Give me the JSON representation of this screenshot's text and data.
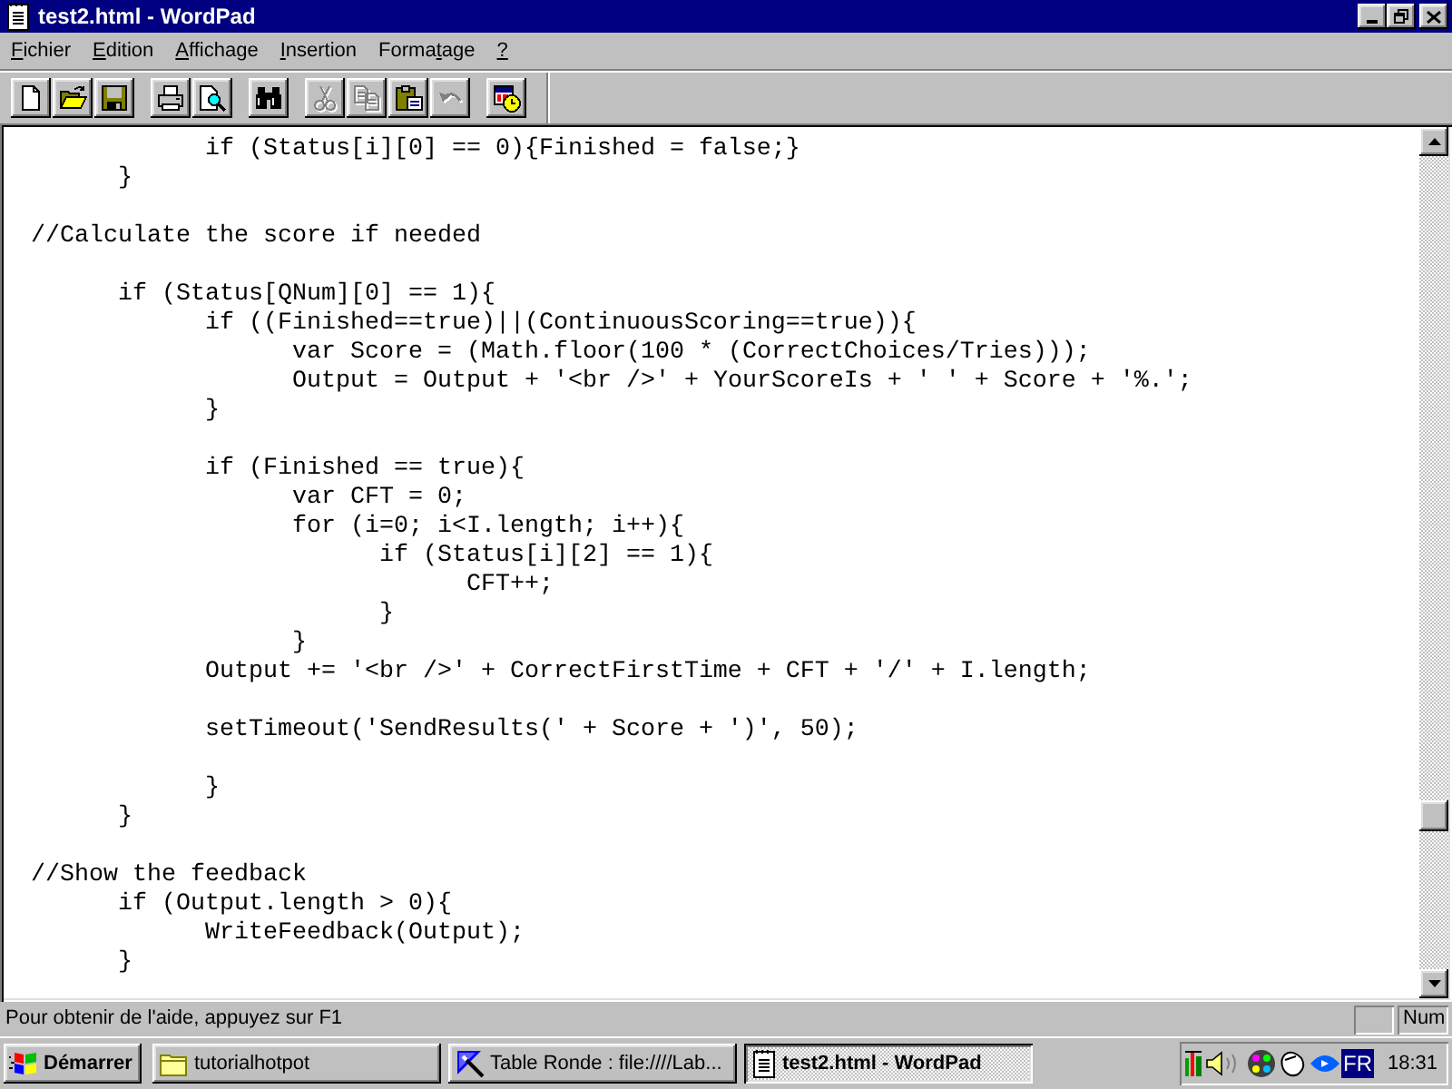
{
  "window": {
    "title": "test2.html - WordPad"
  },
  "menu": [
    {
      "key": "F",
      "after": "ichier"
    },
    {
      "key": "E",
      "after": "dition"
    },
    {
      "key": "A",
      "after": "ffichage"
    },
    {
      "key": "I",
      "after": "nsertion"
    },
    {
      "before": "Forma",
      "key": "t",
      "after": "age"
    },
    {
      "key": "?"
    }
  ],
  "toolbar": {
    "groups": [
      [
        {
          "kind": "new",
          "disabled": false
        },
        {
          "kind": "open",
          "disabled": false
        },
        {
          "kind": "save",
          "disabled": false
        }
      ],
      [
        {
          "kind": "print",
          "disabled": false
        },
        {
          "kind": "print_preview",
          "disabled": false
        }
      ],
      [
        {
          "kind": "find",
          "disabled": false
        }
      ],
      [
        {
          "kind": "cut",
          "disabled": true
        },
        {
          "kind": "copy",
          "disabled": true
        },
        {
          "kind": "paste",
          "disabled": false
        },
        {
          "kind": "undo",
          "disabled": true
        }
      ],
      [
        {
          "kind": "date_time",
          "disabled": false
        }
      ]
    ]
  },
  "document": {
    "blocks": [
      [
        "\t\tif (Status[i][0] == 0){Finished = false;}",
        "\t}"
      ],
      [
        "//Calculate the score if needed"
      ],
      [
        "\tif (Status[QNum][0] == 1){",
        "\t\tif ((Finished==true)||(ContinuousScoring==true)){",
        "\t\t\tvar Score = (Math.floor(100 * (CorrectChoices/Tries)));",
        "\t\t\tOutput = Output + '<br />' + YourScoreIs + ' ' + Score + '%.';",
        "\t\t}"
      ],
      [
        "\t\tif (Finished == true){",
        "\t\t\tvar CFT = 0;",
        "\t\t\tfor (i=0; i<I.length; i++){",
        "\t\t\t\tif (Status[i][2] == 1){",
        "\t\t\t\t\tCFT++;",
        "\t\t\t\t}",
        "\t\t\t}",
        "\t\tOutput += '<br />' + CorrectFirstTime + CFT + '/' + I.length;"
      ],
      [
        "\t\tsetTimeout('SendResults(' + Score + ')', 50);"
      ],
      [
        "\t\t}",
        "\t}"
      ],
      [
        "//Show the feedback",
        "\tif (Output.length > 0){",
        "\t\tWriteFeedback(Output);",
        "\t}"
      ]
    ]
  },
  "status_bar": {
    "message": "Pour obtenir de l'aide, appuyez sur F1",
    "num_indicator": "Num"
  },
  "taskbar": {
    "start_button": "Démarrer",
    "tasks": [
      {
        "label": "tutorialhotpot",
        "kind": "folder",
        "selected": false
      },
      {
        "label": "Table Ronde : file:////Lab...",
        "kind": "browser",
        "selected": false
      },
      {
        "label": "test2.html - WordPad",
        "kind": "document",
        "selected": true
      }
    ],
    "tray": {
      "language": "FR",
      "clock": "18:31"
    }
  }
}
